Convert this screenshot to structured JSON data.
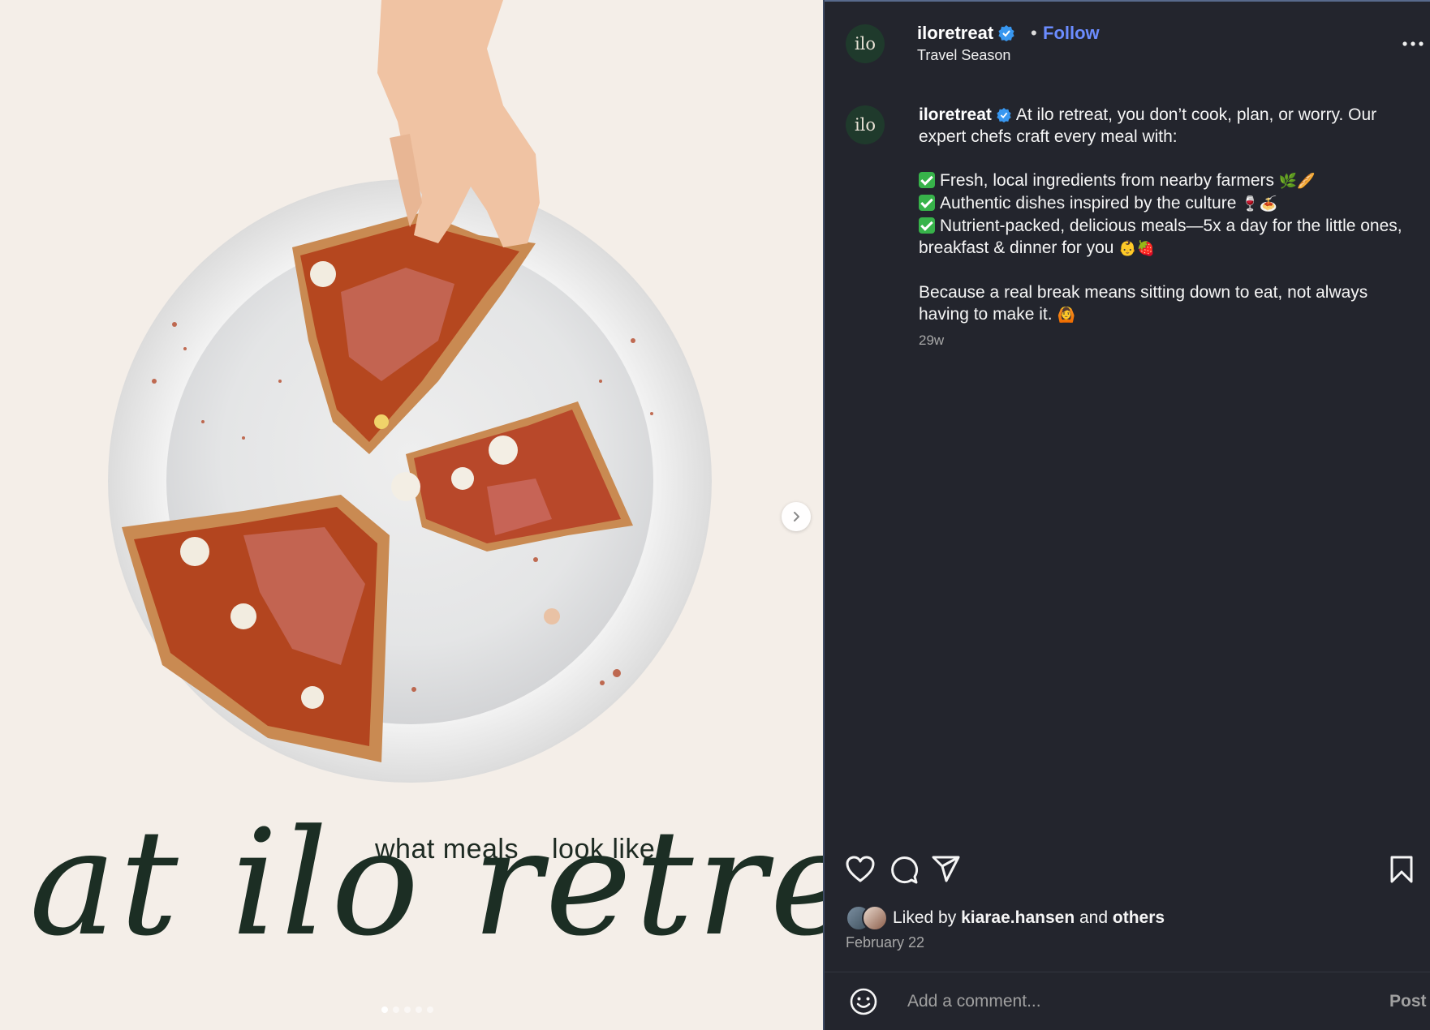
{
  "post_image": {
    "overlay_small_left": "what meals",
    "overlay_small_right": "look like",
    "overlay_big": "at ilo retreat",
    "next_icon": "chevron-right-icon",
    "carousel_dots": 5,
    "carousel_active_index": 0
  },
  "header": {
    "avatar_text": "ilo",
    "username": "iloretreat",
    "separator": "•",
    "follow_label": "Follow",
    "subtitle": "Travel Season",
    "more_icon": "more-horizontal-icon"
  },
  "caption": {
    "avatar_text": "ilo",
    "username": "iloretreat",
    "intro": "At ilo retreat, you don’t cook, plan, or worry. Our expert chefs craft every meal with:",
    "bullets": [
      {
        "text": "Fresh, local ingredients from nearby farmers",
        "emoji": "🌿🥖"
      },
      {
        "text": "Authentic dishes inspired by the culture",
        "emoji": "🍷🍝"
      },
      {
        "text": "Nutrient-packed, delicious meals—5x a day for the little ones, breakfast & dinner for you",
        "emoji": "👶🍓"
      }
    ],
    "closing": "Because a real break means sitting down to eat, not always having to make it.",
    "closing_emoji": "🙆",
    "time": "29w"
  },
  "actions": {
    "like_icon": "heart-icon",
    "comment_icon": "comment-icon",
    "share_icon": "send-icon",
    "save_icon": "bookmark-icon"
  },
  "likes": {
    "prefix": "Liked by",
    "user": "kiarae.hansen",
    "and": "and",
    "others": "others"
  },
  "date": "February 22",
  "comment": {
    "emoji_icon": "smiley-icon",
    "placeholder": "Add a comment...",
    "post_label": "Post"
  },
  "colors": {
    "panel_bg": "#23252d",
    "accent_link": "#6b8cff",
    "verified": "#3897f0",
    "overlay_text": "#1c2e24",
    "image_bg": "#f4eee8"
  }
}
